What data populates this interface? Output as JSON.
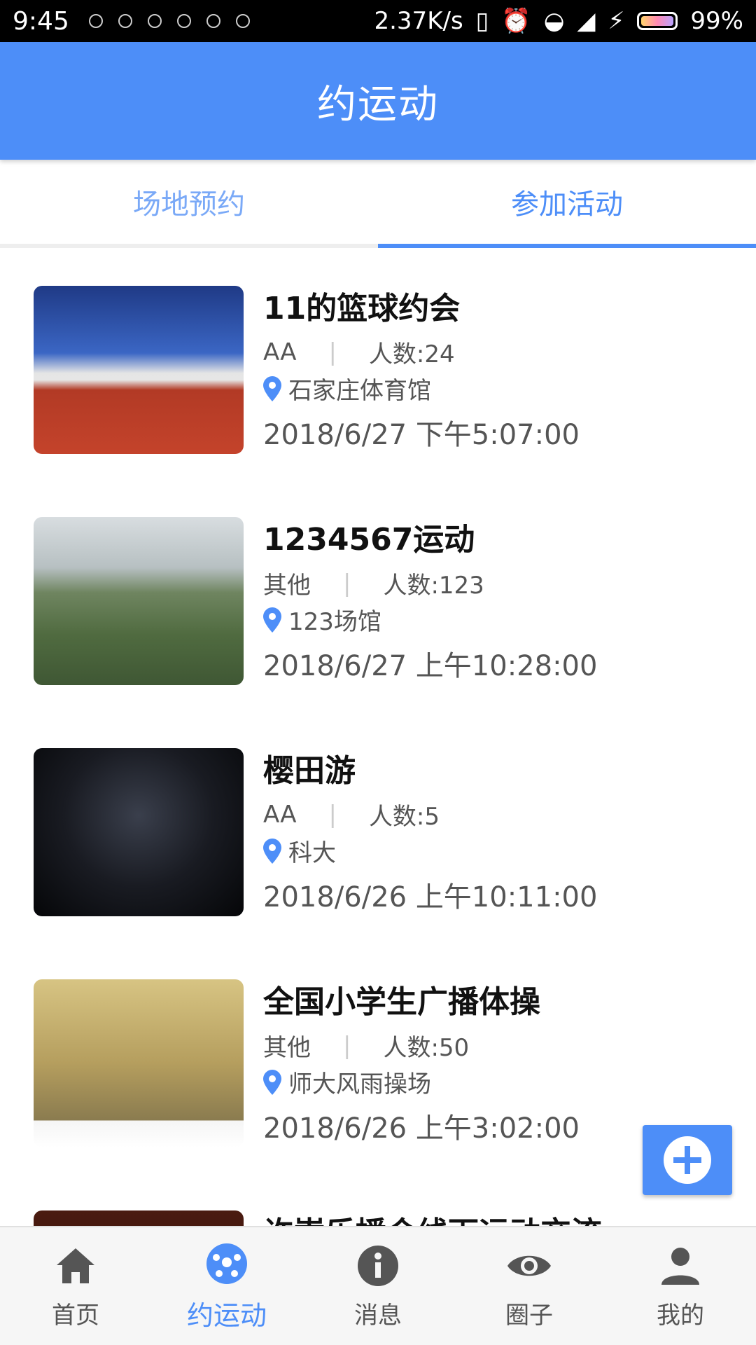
{
  "status_bar": {
    "time": "9:45",
    "speed": "2.37K/s",
    "battery": "99%"
  },
  "header": {
    "title": "约运动"
  },
  "tabs": [
    {
      "label": "场地预约",
      "active": false
    },
    {
      "label": "参加活动",
      "active": true
    }
  ],
  "events": [
    {
      "title": "11的篮球约会",
      "type": "AA",
      "people": "人数:24",
      "location": "石家庄体育馆",
      "datetime": "2018/6/27 下午5:07:00"
    },
    {
      "title": "1234567运动",
      "type": "其他",
      "people": "人数:123",
      "location": "123场馆",
      "datetime": "2018/6/27 上午10:28:00"
    },
    {
      "title": "樱田游",
      "type": "AA",
      "people": "人数:5",
      "location": "科大",
      "datetime": "2018/6/26 上午10:11:00"
    },
    {
      "title": "全国小学生广播体操",
      "type": "其他",
      "people": "人数:50",
      "location": "师大风雨操场",
      "datetime": "2018/6/26 上午3:02:00"
    },
    {
      "title": "许嵩乐播会线下运动交流"
    }
  ],
  "fab": {
    "icon": "add-icon"
  },
  "bottom_nav": [
    {
      "label": "首页",
      "icon": "home-icon",
      "active": false
    },
    {
      "label": "约运动",
      "icon": "soccer-ball-icon",
      "active": true
    },
    {
      "label": "消息",
      "icon": "info-icon",
      "active": false
    },
    {
      "label": "圈子",
      "icon": "eye-icon",
      "active": false
    },
    {
      "label": "我的",
      "icon": "person-icon",
      "active": false
    }
  ],
  "colors": {
    "accent": "#4d8ef8",
    "tab_inactive": "#7aa9f7",
    "nav_inactive": "#555555"
  }
}
